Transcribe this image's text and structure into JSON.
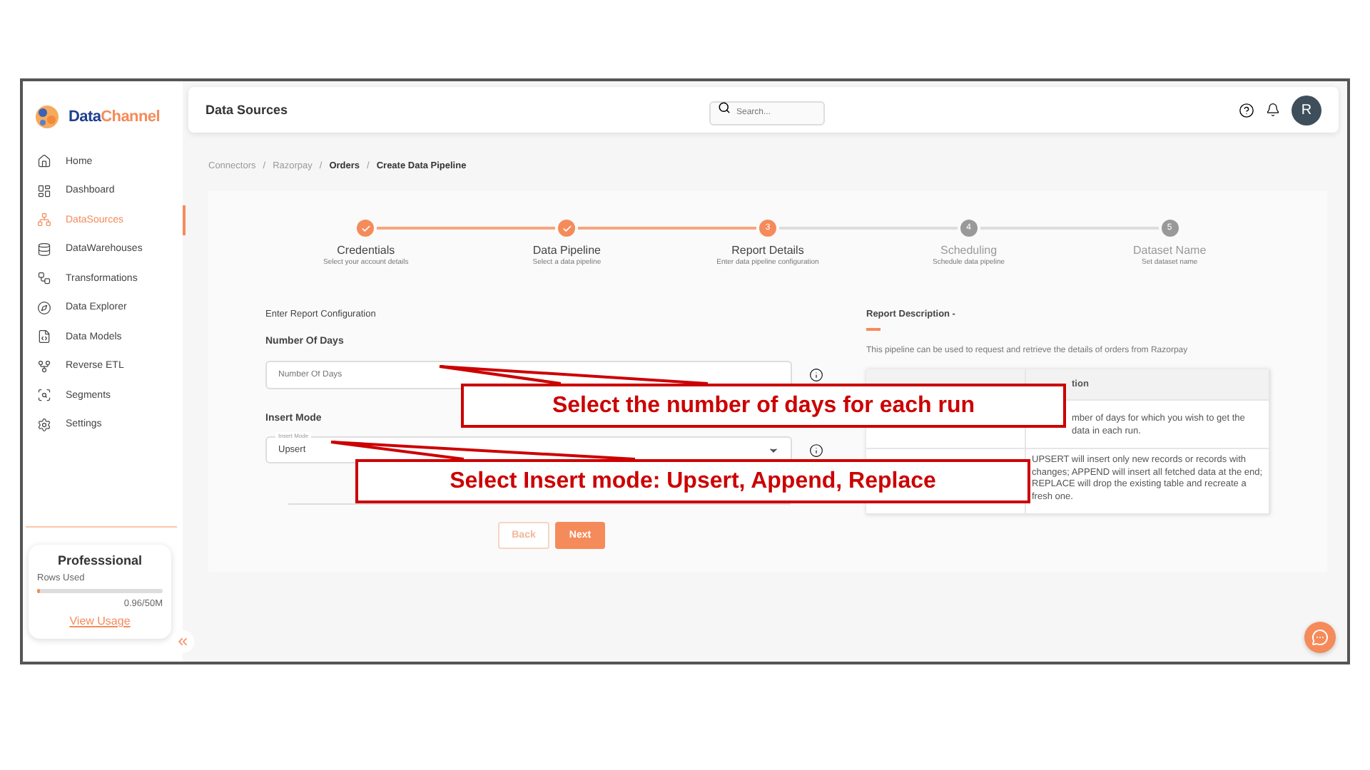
{
  "logo": {
    "primary": "Data",
    "secondary": "Channel"
  },
  "sidebar": {
    "items": [
      {
        "label": "Home",
        "selected": false
      },
      {
        "label": "Dashboard",
        "selected": false
      },
      {
        "label": "DataSources",
        "selected": true
      },
      {
        "label": "DataWarehouses",
        "selected": false
      },
      {
        "label": "Transformations",
        "selected": false
      },
      {
        "label": "Data Explorer",
        "selected": false
      },
      {
        "label": "Data Models",
        "selected": false
      },
      {
        "label": "Reverse ETL",
        "selected": false
      },
      {
        "label": "Segments",
        "selected": false
      },
      {
        "label": "Settings",
        "selected": false
      }
    ]
  },
  "plan": {
    "name": "Professsional",
    "label": "Rows Used",
    "level": 0.02,
    "usage": "0.96/50M",
    "link": "View Usage"
  },
  "header": {
    "title": "Data Sources",
    "search": {
      "placeholder": "Search..."
    },
    "avatar": "R"
  },
  "breadcrumb": [
    {
      "label": "Connectors",
      "active": false
    },
    {
      "label": "/",
      "active": false
    },
    {
      "label": "Razorpay",
      "active": false
    },
    {
      "label": "/",
      "active": false
    },
    {
      "label": "Orders",
      "active": true
    },
    {
      "label": "/",
      "active": false
    },
    {
      "label": "Create Data Pipeline",
      "active": true
    }
  ],
  "steps": [
    {
      "done": true,
      "current": false,
      "title": "Credentials",
      "subtitle": "Select your account details"
    },
    {
      "done": true,
      "current": false,
      "title": "Data Pipeline",
      "subtitle": "Select a data pipeline"
    },
    {
      "done": false,
      "current": true,
      "number": "3",
      "title": "Report Details",
      "subtitle": "Enter data pipeline configuration"
    },
    {
      "done": false,
      "current": false,
      "number": "4",
      "title": "Scheduling",
      "subtitle": "Schedule data pipeline"
    },
    {
      "done": false,
      "current": false,
      "number": "5",
      "title": "Dataset Name",
      "subtitle": "Set dataset name"
    }
  ],
  "form": {
    "heading": "Enter Report Configuration",
    "fields": [
      {
        "kind": "text",
        "label": "Number Of Days",
        "placeholder": "Number Of Days"
      },
      {
        "kind": "select",
        "label": "Insert Mode",
        "floating_label": "Insert Mode",
        "value": "Upsert"
      }
    ],
    "buttons": [
      {
        "label": "Back",
        "disabled": true
      },
      {
        "label": "Next",
        "disabled": false
      }
    ]
  },
  "description": {
    "title": "Report Description -",
    "text": "This pipeline can be used to request and retrieve the details of orders from Razorpay",
    "table": {
      "header": "tion",
      "rows": [
        "mber of days for which you wish to get the data in each run.",
        "UPSERT will insert only new records or records with changes; APPEND will insert all fetched data at the end; REPLACE will drop the existing table and recreate a fresh one."
      ]
    }
  },
  "callouts": [
    "Select the number of days for each run",
    "Select Insert mode: Upsert, Append, Replace"
  ]
}
